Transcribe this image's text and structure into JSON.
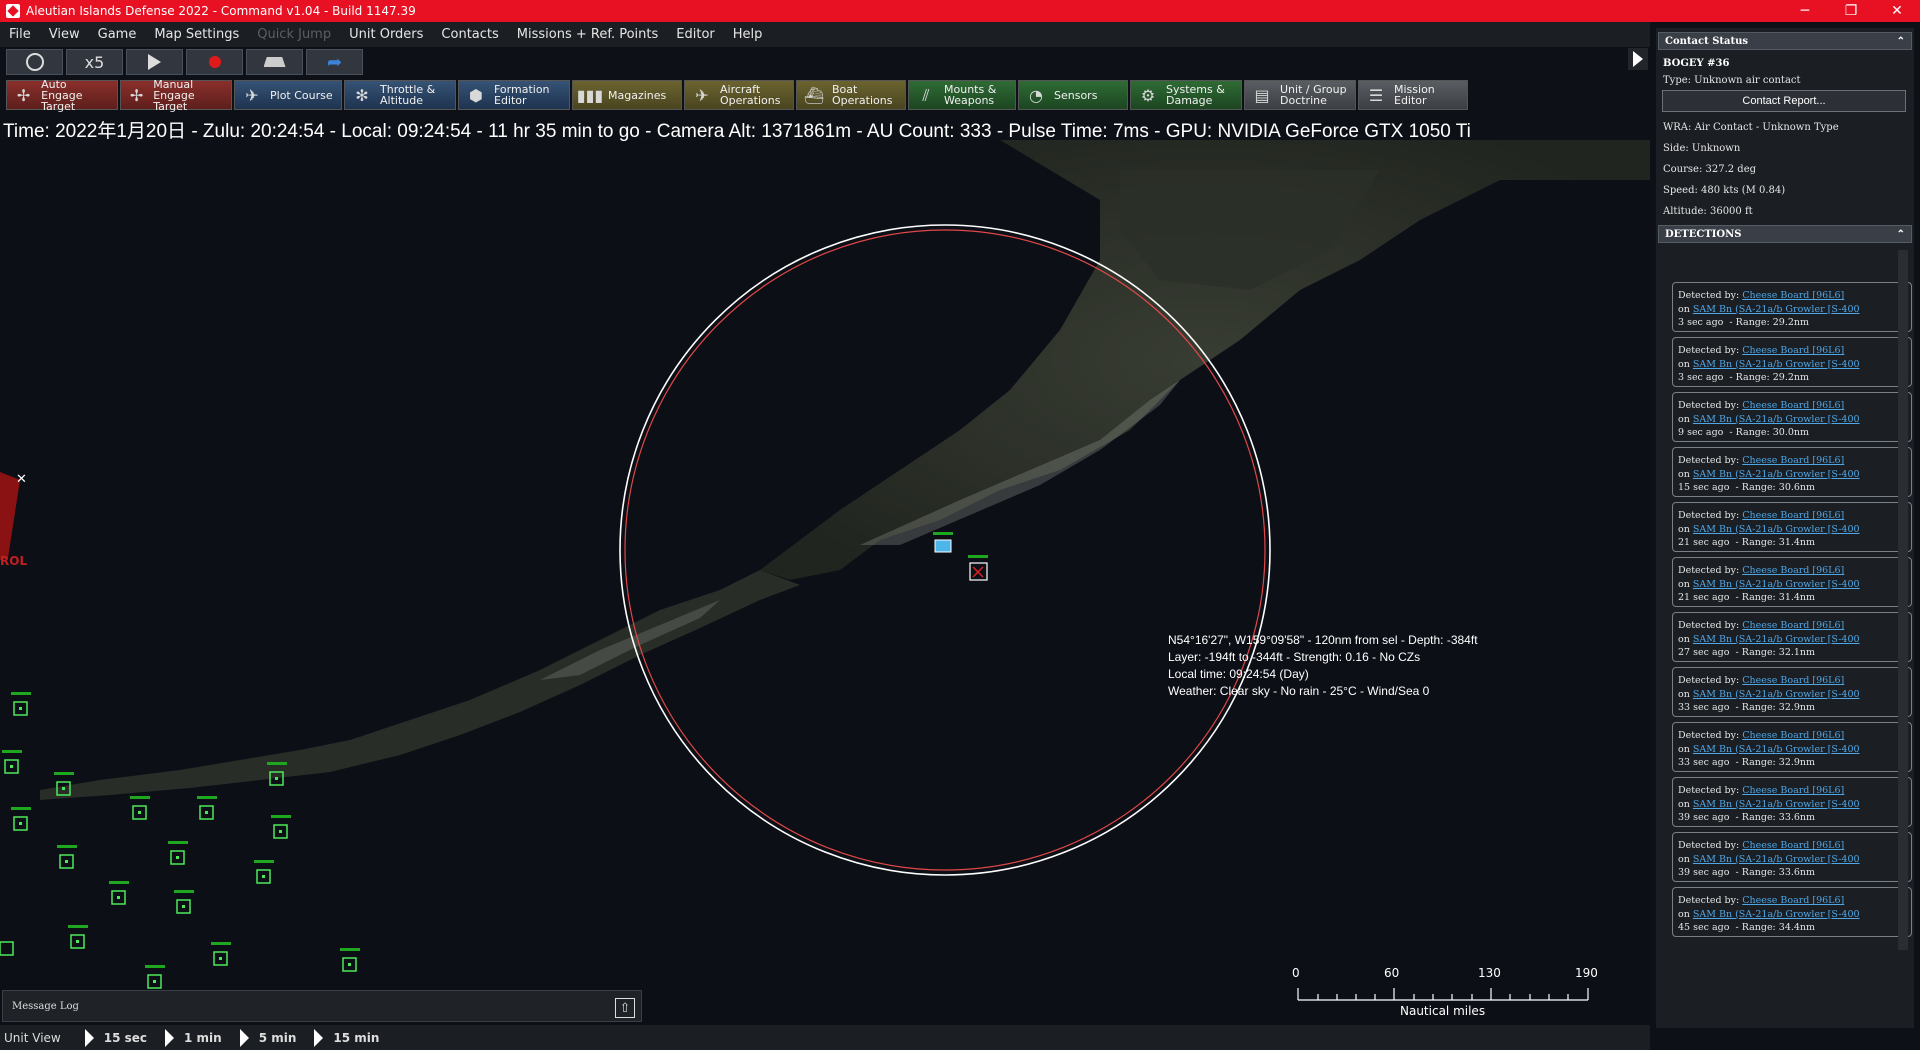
{
  "window": {
    "title": "Aleutian Islands Defense 2022 - Command v1.04 - Build 1147.39",
    "minimize": "─",
    "restore": "❐",
    "close": "✕"
  },
  "menu": {
    "items": [
      "File",
      "View",
      "Game",
      "Map Settings",
      "Quick Jump",
      "Unit Orders",
      "Contacts",
      "Missions + Ref. Points",
      "Editor",
      "Help"
    ]
  },
  "controls": {
    "speed": "x5"
  },
  "toolbar": {
    "buttons": [
      {
        "l1": "Auto Engage",
        "l2": "Target",
        "icon": "crosshair-icon"
      },
      {
        "l1": "Manual",
        "l2": "Engage Target",
        "icon": "crosshair-icon"
      },
      {
        "l1": "Plot Course",
        "l2": "",
        "icon": "course-icon"
      },
      {
        "l1": "Throttle &",
        "l2": "Altitude",
        "icon": "throttle-icon"
      },
      {
        "l1": "Formation",
        "l2": "Editor",
        "icon": "formation-icon"
      },
      {
        "l1": "Magazines",
        "l2": "",
        "icon": "magazine-icon"
      },
      {
        "l1": "Aircraft",
        "l2": "Operations",
        "icon": "aircraft-icon"
      },
      {
        "l1": "Boat",
        "l2": "Operations",
        "icon": "boat-icon"
      },
      {
        "l1": "Mounts &",
        "l2": "Weapons",
        "icon": "mounts-icon"
      },
      {
        "l1": "Sensors",
        "l2": "",
        "icon": "sensor-icon"
      },
      {
        "l1": "Systems &",
        "l2": "Damage",
        "icon": "gear-icon"
      },
      {
        "l1": "Unit / Group",
        "l2": "Doctrine",
        "icon": "doctrine-icon"
      },
      {
        "l1": "Mission",
        "l2": "Editor",
        "icon": "mission-icon"
      }
    ]
  },
  "status_line": "Time: 2022年1月20日 - Zulu: 20:24:54 - Local: 09:24:54 - 11 hr 35 min to go -  Camera Alt: 1371861m  - AU Count: 333 - Pulse Time: 7ms - GPU: NVIDIA GeForce GTX 1050 Ti",
  "map": {
    "left_label": "ROL",
    "cursor_info": [
      "N54°16'27\", W159°09'58\" - 120nm from sel - Depth: -384ft",
      "Layer: -194ft to -344ft - Strength: 0.16 - No CZs",
      "Local time: 09:24:54 (Day)",
      "Weather: Clear sky - No rain - 25°C - Wind/Sea 0"
    ],
    "scale": {
      "ticks": [
        "0",
        "60",
        "130",
        "190"
      ],
      "unit": "Nautical miles"
    }
  },
  "contact_status": {
    "header": "Contact Status",
    "name": "BOGEY #36",
    "type": "Type: Unknown air contact",
    "report_button": "Contact Report...",
    "wra": "WRA: Air Contact - Unknown Type",
    "side": "Side: Unknown",
    "course": "Course: 327.2 deg",
    "speed": "Speed: 480 kts (M 0.84)",
    "altitude": "Altitude: 36000 ft"
  },
  "detections": {
    "header": "DETECTIONS",
    "detected_prefix": "Detected by: ",
    "sensor": "Cheese Board [96L6]",
    "on_prefix": "on ",
    "unit": "SAM Bn (SA-21a/b Growler [S-400",
    "items": [
      {
        "age": "3 sec ago",
        "range": "Range: 29.2nm"
      },
      {
        "age": "3 sec ago",
        "range": "Range: 29.2nm"
      },
      {
        "age": "9 sec ago",
        "range": "Range: 30.0nm"
      },
      {
        "age": "15 sec ago",
        "range": "Range: 30.6nm"
      },
      {
        "age": "21 sec ago",
        "range": "Range: 31.4nm"
      },
      {
        "age": "21 sec ago",
        "range": "Range: 31.4nm"
      },
      {
        "age": "27 sec ago",
        "range": "Range: 32.1nm"
      },
      {
        "age": "33 sec ago",
        "range": "Range: 32.9nm"
      },
      {
        "age": "33 sec ago",
        "range": "Range: 32.9nm"
      },
      {
        "age": "39 sec ago",
        "range": "Range: 33.6nm"
      },
      {
        "age": "39 sec ago",
        "range": "Range: 33.6nm"
      },
      {
        "age": "45 sec ago",
        "range": "Range: 34.4nm"
      }
    ]
  },
  "message_log": "Message Log",
  "bottom": {
    "unit_view": "Unit View",
    "steps": [
      "15 sec",
      "1 min",
      "5 min",
      "15 min"
    ]
  }
}
